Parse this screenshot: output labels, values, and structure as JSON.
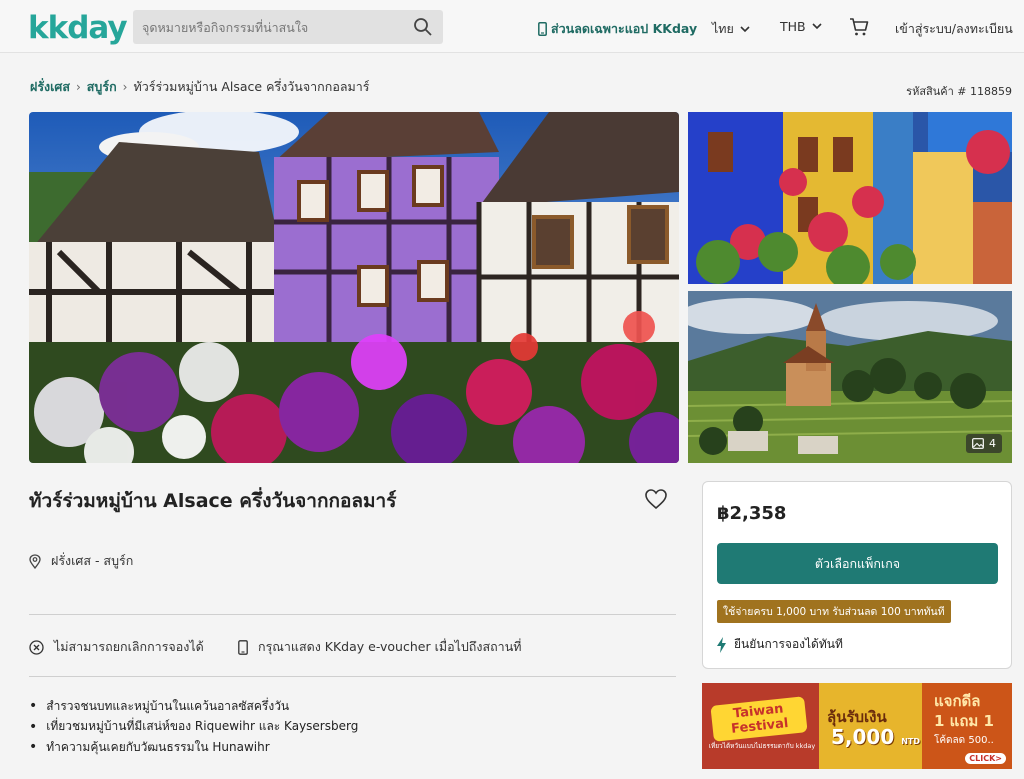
{
  "header": {
    "logo": "kkday",
    "search_placeholder": "จุดหมายหรือกิจกรรมที่น่าสนใจ",
    "app_link": "ส่วนลดเฉพาะแอป KKday",
    "language": "ไทย",
    "currency": "THB",
    "login": "เข้าสู่ระบบ/ลงทะเบียน"
  },
  "breadcrumb": {
    "items": [
      "ฝรั่งเศส",
      "สบูร์ก"
    ],
    "current": "ทัวร์ร่วมหมู่บ้าน Alsace ครึ่งวันจากกอลมาร์"
  },
  "product_code": "รหัสสินค้า # 118859",
  "gallery": {
    "photo_count": "4"
  },
  "product": {
    "title": "ทัวร์ร่วมหมู่บ้าน Alsace ครึ่งวันจากกอลมาร์",
    "location": "ฝรั่งเศส - สบูร์ก",
    "policy_cancel": "ไม่สามารถยกเลิกการจองได้",
    "policy_voucher": "กรุณาแสดง KKday e-voucher เมื่อไปถึงสถานที่",
    "highlights": [
      "สำรวจชนบทและหมู่บ้านในแคว้นอาลซัสครึ่งวัน",
      "เที่ยวชมหมู่บ้านที่มีเสน่ห์ของ Riquewihr และ Kaysersberg",
      "ทำความคุ้นเคยกับวัฒนธรรมใน Hunawihr"
    ]
  },
  "booking": {
    "price": "฿2,358",
    "cta": "ตัวเลือกแพ็กเกจ",
    "promo": "ใช้จ่ายครบ 1,000 บาท รับส่วนลด 100 บาททันที",
    "instant": "ยืนยันการจองได้ทันที"
  },
  "banner": {
    "festival": "Taiwan Festival",
    "festival_sub": "เที่ยวไต้หวันแบบไม่ธรรมดากับ kkday",
    "mid_line1": "ลุ้นรับเงิน",
    "mid_amount": "5,000",
    "mid_unit": "NTD",
    "right_line1": "แจกดีล",
    "right_line2": "1 แถม 1",
    "right_line3": "โค้ดลด 500..",
    "click": "CLICK>"
  },
  "colors": {
    "brand": "#26a69a",
    "primary_button": "#1f7a74",
    "promo_badge": "#a0731f",
    "link": "#1f6b63"
  }
}
